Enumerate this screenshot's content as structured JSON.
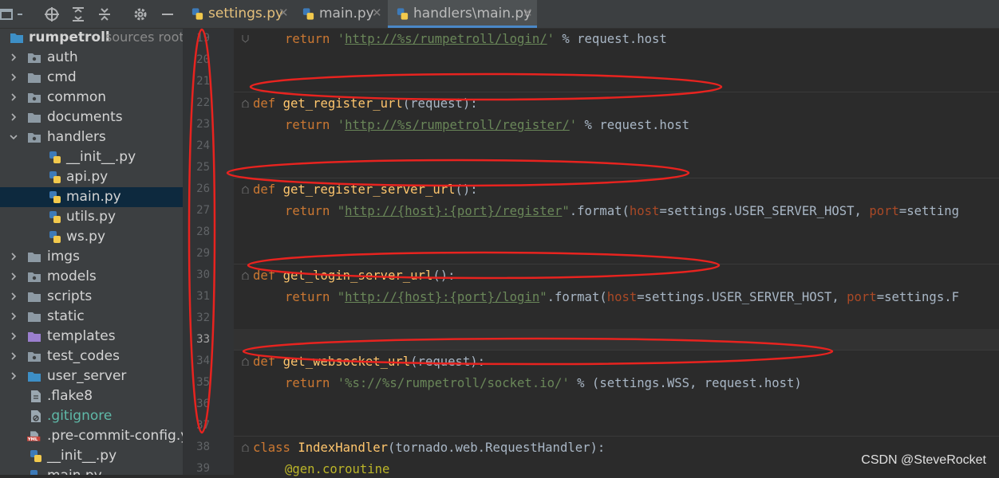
{
  "tabs": [
    {
      "label": "settings.py",
      "active": false
    },
    {
      "label": "main.py",
      "active": false
    },
    {
      "label": "handlers\\main.py",
      "active": true
    }
  ],
  "project": {
    "root_name": "rumpetroll",
    "root_hint": "sources root,",
    "items": [
      {
        "label": "auth",
        "type": "folder"
      },
      {
        "label": "cmd",
        "type": "folder"
      },
      {
        "label": "common",
        "type": "folder"
      },
      {
        "label": "documents",
        "type": "folder"
      },
      {
        "label": "handlers",
        "type": "folder-open"
      },
      {
        "label": "__init__.py",
        "type": "py"
      },
      {
        "label": "api.py",
        "type": "py"
      },
      {
        "label": "main.py",
        "type": "py",
        "selected": true
      },
      {
        "label": "utils.py",
        "type": "py"
      },
      {
        "label": "ws.py",
        "type": "py"
      },
      {
        "label": "imgs",
        "type": "folder"
      },
      {
        "label": "models",
        "type": "folder"
      },
      {
        "label": "scripts",
        "type": "folder"
      },
      {
        "label": "static",
        "type": "folder"
      },
      {
        "label": "templates",
        "type": "folder-purple"
      },
      {
        "label": "test_codes",
        "type": "folder"
      },
      {
        "label": "user_server",
        "type": "folder-blue"
      },
      {
        "label": ".flake8",
        "type": "file"
      },
      {
        "label": ".gitignore",
        "type": "file-git"
      },
      {
        "label": ".pre-commit-config.ya",
        "type": "yml"
      },
      {
        "label": "__init__.py",
        "type": "py"
      },
      {
        "label": "main.py",
        "type": "py"
      }
    ]
  },
  "line_numbers": [
    "19",
    "20",
    "21",
    "22",
    "23",
    "24",
    "25",
    "26",
    "27",
    "28",
    "29",
    "30",
    "31",
    "32",
    "33",
    "34",
    "35",
    "36",
    "37",
    "38",
    "39"
  ],
  "code": {
    "l19": {
      "ret": "return ",
      "q1": "'",
      "url": "http://%s/rumpetroll/login/",
      "q2": "'",
      "rest": " % request.host"
    },
    "l22": {
      "def": "def ",
      "name": "get_register_url",
      "args": "(request):"
    },
    "l23": {
      "ret": "return ",
      "q1": "'",
      "url": "http://%s/rumpetroll/register/",
      "q2": "'",
      "rest": " % request.host"
    },
    "l26": {
      "def": "def ",
      "name": "get_register_server_url",
      "args": "():"
    },
    "l27": {
      "ret": "return ",
      "q1": "\"",
      "url": "http://{host}:{port}/register",
      "q2": "\"",
      "m": ".format(",
      "p1": "host",
      "v1": "=settings.USER_SERVER_HOST, ",
      "p2": "port",
      "v2": "=setting"
    },
    "l30": {
      "def": "def ",
      "name": "get_login_server_url",
      "args": "():"
    },
    "l31": {
      "ret": "return ",
      "q1": "\"",
      "url": "http://{host}:{port}/login",
      "q2": "\"",
      "m": ".format(",
      "p1": "host",
      "v1": "=settings.USER_SERVER_HOST, ",
      "p2": "port",
      "v2": "=settings.F"
    },
    "l34": {
      "def": "def ",
      "name": "get_websocket_url",
      "args": "(request):"
    },
    "l35": {
      "ret": "return ",
      "s": "'%s://%s/rumpetroll/socket.io/'",
      "rest": " % (settings.WSS, request.host)"
    },
    "l38": {
      "cls": "class ",
      "name": "IndexHandler",
      "args": "(tornado.web.RequestHandler):"
    },
    "l39": {
      "deco": "@gen.coroutine"
    }
  },
  "watermark": "CSDN @SteveRocket",
  "colors": {
    "annotation": "#e8231f",
    "accent": "#4a88c7"
  }
}
